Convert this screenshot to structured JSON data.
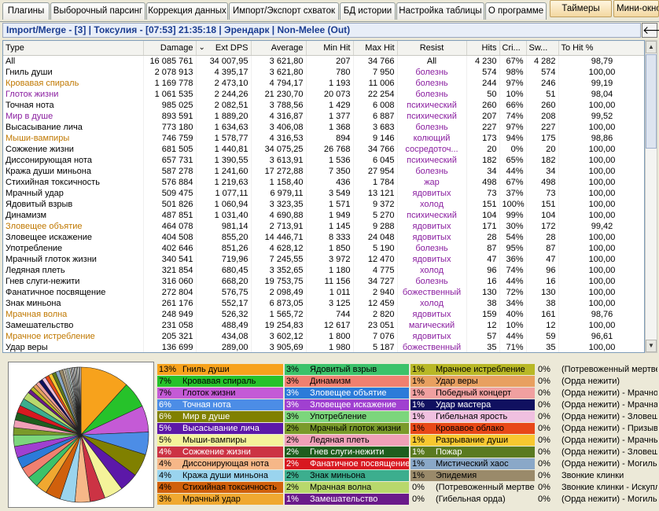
{
  "tabs": [
    "Плагины",
    "Выборочный парсинг",
    "Коррекция данных",
    "Импорт/Экспорт схваток",
    "БД истории",
    "Настройка таблицы",
    "О программе"
  ],
  "buttons": {
    "timers": "Таймеры",
    "mini": "Мини-окно"
  },
  "title": "Import/Merge - [3] | Токсулия - [07:53] 21:35:18 | Эрендарк | Non-Melee (Out)",
  "back_icon": "back-arrow-icon",
  "columns": [
    "Type",
    "Damage",
    "Ext DPS",
    "Average",
    "Min Hit",
    "Max Hit",
    "Resist",
    "Hits",
    "Cri...",
    "Sw...",
    "To Hit %"
  ],
  "sort_indicator": "⌄",
  "colors": {
    "orange": "#c07800",
    "purple": "#8a1ea0",
    "title": "#1b3d91"
  },
  "rows": [
    {
      "type": "All",
      "damage": "16 085 761",
      "dps": "34 007,95",
      "avg": "3 621,80",
      "min": "207",
      "max": "34 766",
      "resist": "All",
      "hits": "4 230",
      "crit": "67%",
      "sw": "4 282",
      "tohit": "98,79",
      "color": "black"
    },
    {
      "type": "Гниль души",
      "damage": "2 078 913",
      "dps": "4 395,17",
      "avg": "3 621,80",
      "min": "780",
      "max": "7 950",
      "resist": "болезнь",
      "hits": "574",
      "crit": "98%",
      "sw": "574",
      "tohit": "100,00",
      "color": "black"
    },
    {
      "type": "Кровавая спираль",
      "damage": "1 169 778",
      "dps": "2 473,10",
      "avg": "4 794,17",
      "min": "1 193",
      "max": "11 006",
      "resist": "болезнь",
      "hits": "244",
      "crit": "97%",
      "sw": "246",
      "tohit": "99,19",
      "color": "orange"
    },
    {
      "type": "Глоток жизни",
      "damage": "1 061 535",
      "dps": "2 244,26",
      "avg": "21 230,70",
      "min": "20 073",
      "max": "22 254",
      "resist": "болезнь",
      "hits": "50",
      "crit": "10%",
      "sw": "51",
      "tohit": "98,04",
      "color": "purple"
    },
    {
      "type": "Точная нота",
      "damage": "985 025",
      "dps": "2 082,51",
      "avg": "3 788,56",
      "min": "1 429",
      "max": "6 008",
      "resist": "психический",
      "hits": "260",
      "crit": "66%",
      "sw": "260",
      "tohit": "100,00",
      "color": "black"
    },
    {
      "type": "Мир в душе",
      "damage": "893 591",
      "dps": "1 889,20",
      "avg": "4 316,87",
      "min": "1 377",
      "max": "6 887",
      "resist": "психический",
      "hits": "207",
      "crit": "74%",
      "sw": "208",
      "tohit": "99,52",
      "color": "purple"
    },
    {
      "type": "Высасывание лича",
      "damage": "773 180",
      "dps": "1 634,63",
      "avg": "3 406,08",
      "min": "1 368",
      "max": "3 683",
      "resist": "болезнь",
      "hits": "227",
      "crit": "97%",
      "sw": "227",
      "tohit": "100,00",
      "color": "black"
    },
    {
      "type": "Мыши-вампиры",
      "damage": "746 759",
      "dps": "1 578,77",
      "avg": "4 316,53",
      "min": "894",
      "max": "9 146",
      "resist": "колющий",
      "hits": "173",
      "crit": "94%",
      "sw": "175",
      "tohit": "98,86",
      "color": "orange"
    },
    {
      "type": "Сожжение жизни",
      "damage": "681 505",
      "dps": "1 440,81",
      "avg": "34 075,25",
      "min": "26 768",
      "max": "34 766",
      "resist": "сосредоточ...",
      "hits": "20",
      "crit": "0%",
      "sw": "20",
      "tohit": "100,00",
      "color": "black"
    },
    {
      "type": "Диссонирующая нота",
      "damage": "657 731",
      "dps": "1 390,55",
      "avg": "3 613,91",
      "min": "1 536",
      "max": "6 045",
      "resist": "психический",
      "hits": "182",
      "crit": "65%",
      "sw": "182",
      "tohit": "100,00",
      "color": "black"
    },
    {
      "type": "Кража души миньона",
      "damage": "587 278",
      "dps": "1 241,60",
      "avg": "17 272,88",
      "min": "7 350",
      "max": "27 954",
      "resist": "болезнь",
      "hits": "34",
      "crit": "44%",
      "sw": "34",
      "tohit": "100,00",
      "color": "black"
    },
    {
      "type": "Стихийная токсичность",
      "damage": "576 884",
      "dps": "1 219,63",
      "avg": "1 158,40",
      "min": "436",
      "max": "1 784",
      "resist": "жар",
      "hits": "498",
      "crit": "67%",
      "sw": "498",
      "tohit": "100,00",
      "color": "black"
    },
    {
      "type": "Мрачный удар",
      "damage": "509 475",
      "dps": "1 077,11",
      "avg": "6 979,11",
      "min": "3 549",
      "max": "13 121",
      "resist": "ядовитых",
      "hits": "73",
      "crit": "37%",
      "sw": "73",
      "tohit": "100,00",
      "color": "black"
    },
    {
      "type": "Ядовитый взрыв",
      "damage": "501 826",
      "dps": "1 060,94",
      "avg": "3 323,35",
      "min": "1 571",
      "max": "9 372",
      "resist": "холод",
      "hits": "151",
      "crit": "100%",
      "sw": "151",
      "tohit": "100,00",
      "color": "black"
    },
    {
      "type": "Динамизм",
      "damage": "487 851",
      "dps": "1 031,40",
      "avg": "4 690,88",
      "min": "1 949",
      "max": "5 270",
      "resist": "психический",
      "hits": "104",
      "crit": "99%",
      "sw": "104",
      "tohit": "100,00",
      "color": "black"
    },
    {
      "type": "Зловещее объятие",
      "damage": "464 078",
      "dps": "981,14",
      "avg": "2 713,91",
      "min": "1 145",
      "max": "9 288",
      "resist": "ядовитых",
      "hits": "171",
      "crit": "30%",
      "sw": "172",
      "tohit": "99,42",
      "color": "orange"
    },
    {
      "type": "Зловещее искажение",
      "damage": "404 508",
      "dps": "855,20",
      "avg": "14 446,71",
      "min": "8 333",
      "max": "24 048",
      "resist": "ядовитых",
      "hits": "28",
      "crit": "54%",
      "sw": "28",
      "tohit": "100,00",
      "color": "black"
    },
    {
      "type": "Употребление",
      "damage": "402 646",
      "dps": "851,26",
      "avg": "4 628,12",
      "min": "1 850",
      "max": "5 190",
      "resist": "болезнь",
      "hits": "87",
      "crit": "95%",
      "sw": "87",
      "tohit": "100,00",
      "color": "black"
    },
    {
      "type": "Мрачный глоток жизни",
      "damage": "340 541",
      "dps": "719,96",
      "avg": "7 245,55",
      "min": "3 972",
      "max": "12 470",
      "resist": "ядовитых",
      "hits": "47",
      "crit": "36%",
      "sw": "47",
      "tohit": "100,00",
      "color": "black"
    },
    {
      "type": "Ледяная плеть",
      "damage": "321 854",
      "dps": "680,45",
      "avg": "3 352,65",
      "min": "1 180",
      "max": "4 775",
      "resist": "холод",
      "hits": "96",
      "crit": "74%",
      "sw": "96",
      "tohit": "100,00",
      "color": "black"
    },
    {
      "type": "Гнев слуги-нежити",
      "damage": "316 060",
      "dps": "668,20",
      "avg": "19 753,75",
      "min": "11 156",
      "max": "34 727",
      "resist": "болезнь",
      "hits": "16",
      "crit": "44%",
      "sw": "16",
      "tohit": "100,00",
      "color": "black"
    },
    {
      "type": "Фанатичное посвящение",
      "damage": "272 804",
      "dps": "576,75",
      "avg": "2 098,49",
      "min": "1 011",
      "max": "2 940",
      "resist": "божественный",
      "hits": "130",
      "crit": "72%",
      "sw": "130",
      "tohit": "100,00",
      "color": "black"
    },
    {
      "type": "Знак миньона",
      "damage": "261 176",
      "dps": "552,17",
      "avg": "6 873,05",
      "min": "3 125",
      "max": "12 459",
      "resist": "холод",
      "hits": "38",
      "crit": "34%",
      "sw": "38",
      "tohit": "100,00",
      "color": "black"
    },
    {
      "type": "Мрачная волна",
      "damage": "248 949",
      "dps": "526,32",
      "avg": "1 565,72",
      "min": "744",
      "max": "2 820",
      "resist": "ядовитых",
      "hits": "159",
      "crit": "40%",
      "sw": "161",
      "tohit": "98,76",
      "color": "orange"
    },
    {
      "type": "Замешательство",
      "damage": "231 058",
      "dps": "488,49",
      "avg": "19 254,83",
      "min": "12 617",
      "max": "23 051",
      "resist": "магический",
      "hits": "12",
      "crit": "10%",
      "sw": "12",
      "tohit": "100,00",
      "color": "black"
    },
    {
      "type": "Мрачное истребление",
      "damage": "205 321",
      "dps": "434,08",
      "avg": "3 602,12",
      "min": "1 800",
      "max": "7 076",
      "resist": "ядовитых",
      "hits": "57",
      "crit": "44%",
      "sw": "59",
      "tohit": "96,61",
      "color": "orange"
    },
    {
      "type": "Удар веры",
      "damage": "136 699",
      "dps": "289,00",
      "avg": "3 905,69",
      "min": "1 980",
      "max": "5 187",
      "resist": "божественный",
      "hits": "35",
      "crit": "71%",
      "sw": "35",
      "tohit": "100,00",
      "color": "black"
    }
  ],
  "legend": [
    {
      "pct": "13%",
      "name": "Гниль души",
      "color": "#f7a21c",
      "value": 13
    },
    {
      "pct": "7%",
      "name": "Кровавая спираль",
      "color": "#26c22a",
      "value": 7
    },
    {
      "pct": "7%",
      "name": "Глоток жизни",
      "color": "#c45ad6",
      "value": 7
    },
    {
      "pct": "6%",
      "name": "Точная нота",
      "color": "#4c8de6",
      "value": 6
    },
    {
      "pct": "6%",
      "name": "Мир в душе",
      "color": "#808000",
      "value": 6
    },
    {
      "pct": "5%",
      "name": "Высасывание лича",
      "color": "#5c18a8",
      "value": 5
    },
    {
      "pct": "5%",
      "name": "Мыши-вампиры",
      "color": "#f4f39a",
      "value": 5
    },
    {
      "pct": "4%",
      "name": "Сожжение жизни",
      "color": "#cc3344",
      "value": 4
    },
    {
      "pct": "4%",
      "name": "Диссонирующая нота",
      "color": "#f6b788",
      "value": 4
    },
    {
      "pct": "4%",
      "name": "Кража души миньона",
      "color": "#9ad4ee",
      "value": 4
    },
    {
      "pct": "4%",
      "name": "Стихийная токсичность",
      "color": "#d0600c",
      "value": 4
    },
    {
      "pct": "3%",
      "name": "Мрачный удар",
      "color": "#f0a830",
      "value": 3
    },
    {
      "pct": "3%",
      "name": "Ядовитый взрыв",
      "color": "#3cc26a",
      "value": 3
    },
    {
      "pct": "3%",
      "name": "Динамизм",
      "color": "#f08070",
      "value": 3
    },
    {
      "pct": "3%",
      "name": "Зловещее объятие",
      "color": "#2b7bd9",
      "value": 3
    },
    {
      "pct": "3%",
      "name": "Зловещее искажение",
      "color": "#a040d0",
      "value": 3
    },
    {
      "pct": "3%",
      "name": "Употребление",
      "color": "#7cd67c",
      "value": 3
    },
    {
      "pct": "2%",
      "name": "Мрачный глоток жизни",
      "color": "#7a9a2a",
      "value": 2
    },
    {
      "pct": "2%",
      "name": "Ледяная плеть",
      "color": "#f0a0b8",
      "value": 2
    },
    {
      "pct": "2%",
      "name": "Гнев слуги-нежити",
      "color": "#1e5e1e",
      "value": 2
    },
    {
      "pct": "2%",
      "name": "Фанатичное посвящение",
      "color": "#d81820",
      "value": 2
    },
    {
      "pct": "2%",
      "name": "Знак миньона",
      "color": "#3cae8e",
      "value": 2
    },
    {
      "pct": "2%",
      "name": "Мрачная волна",
      "color": "#b8d86c",
      "value": 2
    },
    {
      "pct": "1%",
      "name": "Замешательство",
      "color": "#6a1a8a",
      "value": 1
    },
    {
      "pct": "1%",
      "name": "Мрачное истребление",
      "color": "#b8b826",
      "value": 1
    },
    {
      "pct": "1%",
      "name": "Удар веры",
      "color": "#e8a060",
      "value": 1
    },
    {
      "pct": "1%",
      "name": "Победный концерт",
      "color": "#f0a0a0",
      "value": 1
    },
    {
      "pct": "1%",
      "name": "Удар мастера",
      "color": "#101060",
      "value": 1
    },
    {
      "pct": "1%",
      "name": "Гибельная ярость",
      "color": "#f0c0e0",
      "value": 1
    },
    {
      "pct": "1%",
      "name": "Кровавое облако",
      "color": "#e84818",
      "value": 1
    },
    {
      "pct": "1%",
      "name": "Разрывание души",
      "color": "#f8c830",
      "value": 1
    },
    {
      "pct": "1%",
      "name": "Пожар",
      "color": "#5a7a20",
      "value": 1
    },
    {
      "pct": "1%",
      "name": "Мистический хаос",
      "color": "#8aa8c8",
      "value": 1
    },
    {
      "pct": "1%",
      "name": "Эпидемия",
      "color": "#9a8a6a",
      "value": 1
    },
    {
      "pct": "0%",
      "name": "(Потревоженный мертвец)",
      "color": "#d8d0b8",
      "value": 0.5
    },
    {
      "pct": "0%",
      "name": "(Гибельная орда)",
      "color": "#c0c0c0",
      "value": 0.5
    },
    {
      "pct": "0%",
      "name": "(Потревоженный мертвец)",
      "color": "#c8e0c8",
      "value": 0.4
    },
    {
      "pct": "0%",
      "name": "(Орда нежити)",
      "color": "#d8e8f8",
      "value": 0.4
    },
    {
      "pct": "0%",
      "name": "(Орда нежити) - Мрачное истребление",
      "color": "#f0f0d0",
      "value": 0.3
    },
    {
      "pct": "0%",
      "name": "(Орда нежити) - Мрачная волна",
      "color": "#f0e0f0",
      "value": 0.3
    },
    {
      "pct": "0%",
      "name": "(Орда нежити) - Зловещее объятие",
      "color": "#e0f0f0",
      "value": 0.3
    },
    {
      "pct": "0%",
      "name": "(Орда нежити) - Призыв",
      "color": "#e8e8e8",
      "value": 0.3
    },
    {
      "pct": "0%",
      "name": "(Орда нежити) - Мрачный удар",
      "color": "#f8f0e0",
      "value": 0.3
    },
    {
      "pct": "0%",
      "name": "(Орда нежити) - Зловещее искажение",
      "color": "#e0e8f8",
      "value": 0.3
    },
    {
      "pct": "0%",
      "name": "(Орда нежити) - Могильный холод",
      "color": "#f0f8e0",
      "value": 0.3
    },
    {
      "pct": "0%",
      "name": "Звонкие клинки",
      "color": "#f8f8f8",
      "value": 0.3
    },
    {
      "pct": "0%",
      "name": "Звонкие клинки - Искупление",
      "color": "#f0f0f0",
      "value": 0.3
    },
    {
      "pct": "0%",
      "name": "(Орда нежити) - Могильный холод",
      "color": "#f8f0f8",
      "value": 0.3
    }
  ]
}
